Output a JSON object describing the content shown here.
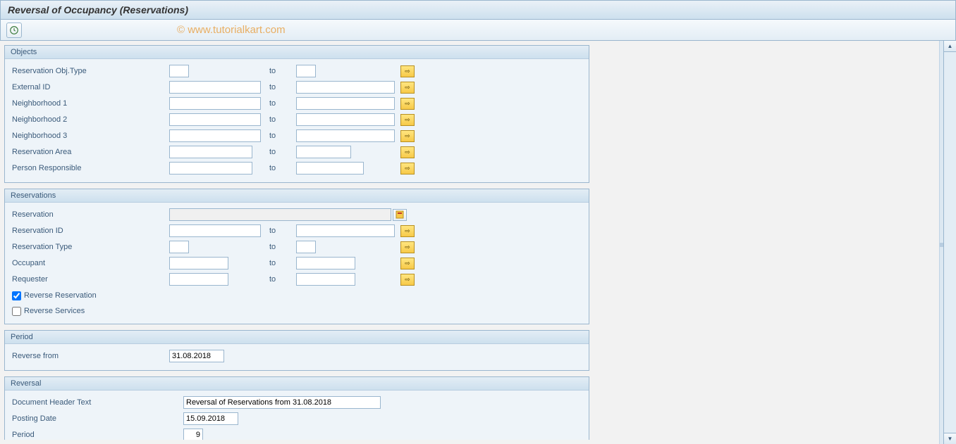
{
  "title": "Reversal of Occupancy (Reservations)",
  "watermark": "© www.tutorialkart.com",
  "groups": {
    "objects": {
      "title": "Objects",
      "rows": {
        "resObjType": {
          "label": "Reservation Obj.Type",
          "to": "to"
        },
        "externalId": {
          "label": "External ID",
          "to": "to"
        },
        "neigh1": {
          "label": "Neighborhood 1",
          "to": "to"
        },
        "neigh2": {
          "label": "Neighborhood 2",
          "to": "to"
        },
        "neigh3": {
          "label": "Neighborhood 3",
          "to": "to"
        },
        "resArea": {
          "label": "Reservation Area",
          "to": "to"
        },
        "personResp": {
          "label": "Person Responsible",
          "to": "to"
        }
      }
    },
    "reservations": {
      "title": "Reservations",
      "rows": {
        "reservation": {
          "label": "Reservation"
        },
        "resId": {
          "label": "Reservation ID",
          "to": "to"
        },
        "resType": {
          "label": "Reservation Type",
          "to": "to"
        },
        "occupant": {
          "label": "Occupant",
          "to": "to"
        },
        "requester": {
          "label": "Requester",
          "to": "to"
        }
      },
      "checkboxes": {
        "reverseRes": {
          "label": "Reverse Reservation",
          "checked": true
        },
        "reverseServ": {
          "label": "Reverse Services",
          "checked": false
        }
      }
    },
    "period": {
      "title": "Period",
      "rows": {
        "reverseFrom": {
          "label": "Reverse from",
          "value": "31.08.2018"
        }
      }
    },
    "reversal": {
      "title": "Reversal",
      "rows": {
        "docHeader": {
          "label": "Document Header Text",
          "value": "Reversal of Reservations from 31.08.2018"
        },
        "postingDate": {
          "label": "Posting Date",
          "value": "15.09.2018"
        },
        "period": {
          "label": "Period",
          "value": "9"
        }
      }
    }
  }
}
